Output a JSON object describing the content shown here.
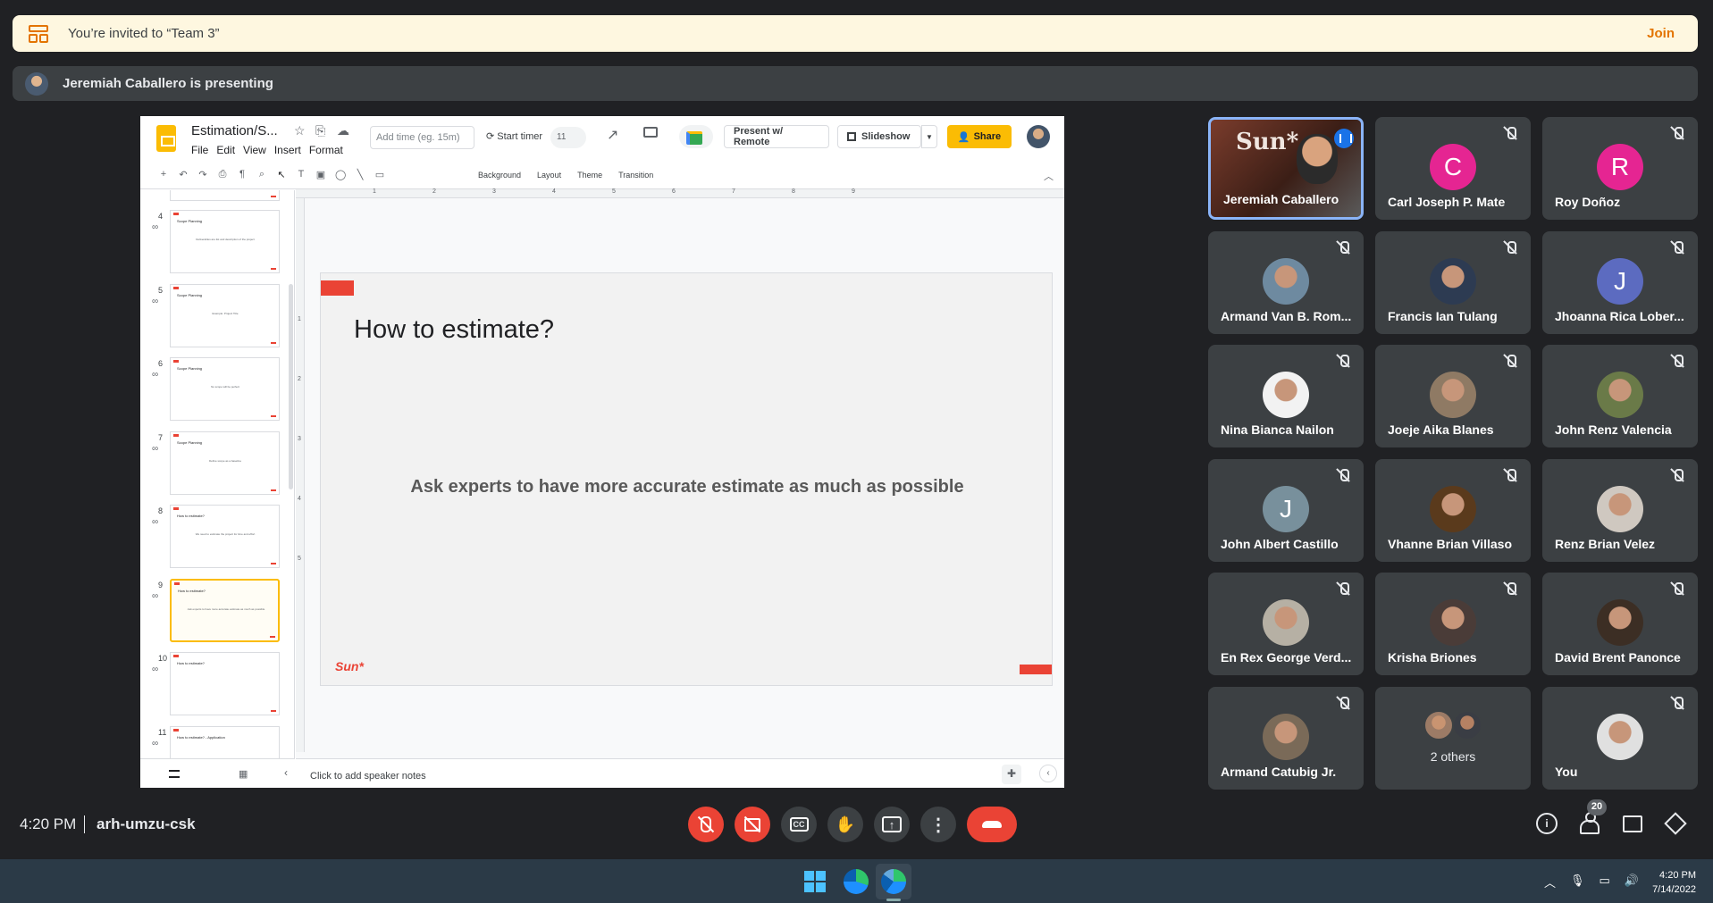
{
  "invite": {
    "text": "You’re invited to “Team 3”",
    "join_label": "Join"
  },
  "presenting": {
    "text": "Jeremiah Caballero is presenting"
  },
  "slides_app": {
    "doc_title": "Estimation/S...",
    "menu": [
      "File",
      "Edit",
      "View",
      "Insert",
      "Format"
    ],
    "time_placeholder": "Add time (eg. 15m)",
    "start_timer_label": "Start timer",
    "timer_badge": "11",
    "present_remote_label": "Present w/ Remote",
    "slideshow_label": "Slideshow",
    "share_label": "Share",
    "toolbar_labels": [
      "Background",
      "Layout",
      "Theme",
      "Transition"
    ],
    "speaker_notes_placeholder": "Click to add speaker notes",
    "filmstrip": [
      {
        "num": "4",
        "title": "Scope Planning",
        "body": "Deliverables are list and description of the project"
      },
      {
        "num": "5",
        "title": "Scope Planning",
        "body": "Example: Project Title"
      },
      {
        "num": "6",
        "title": "Scope Planning",
        "body": "No scope will be perfect"
      },
      {
        "num": "7",
        "title": "Scope Planning",
        "body": "Define scope as a baseline"
      },
      {
        "num": "8",
        "title": "How to estimate?",
        "body": "We need to estimate the project for time and effort"
      },
      {
        "num": "9",
        "title": "How to estimate?",
        "body": "Ask experts to have more accurate estimate as much as possible",
        "selected": true
      },
      {
        "num": "10",
        "title": "How to estimate?",
        "body": ""
      },
      {
        "num": "11",
        "title": "How to estimate? - Application",
        "body": ""
      }
    ],
    "ruler_h": [
      "1",
      "2",
      "3",
      "4",
      "5",
      "6",
      "7",
      "8",
      "9"
    ],
    "ruler_v": [
      "1",
      "2",
      "3",
      "4",
      "5"
    ],
    "slide": {
      "title": "How to estimate?",
      "body": "Ask experts to have more accurate estimate as much as possible",
      "logo": "Sun*",
      "accent_color": "#ea4335"
    }
  },
  "participants": [
    {
      "name": "Jeremiah Caballero",
      "type": "video",
      "speaking": true,
      "scene_text": "Sun*"
    },
    {
      "name": "Carl Joseph P. Mate",
      "type": "letter",
      "letter": "C",
      "color": "#e52592",
      "muted": true
    },
    {
      "name": "Roy Doñoz",
      "type": "letter",
      "letter": "R",
      "color": "#e52592",
      "muted": true
    },
    {
      "name": "Armand Van B. Rom...",
      "type": "photo",
      "tone": "#6e8aa0",
      "muted": true
    },
    {
      "name": "Francis Ian Tulang",
      "type": "photo",
      "tone": "#2d3b52",
      "muted": true
    },
    {
      "name": "Jhoanna Rica Lober...",
      "type": "letter",
      "letter": "J",
      "color": "#5c6bc0",
      "muted": true
    },
    {
      "name": "Nina Bianca Nailon",
      "type": "photo",
      "tone": "#f2f2f2",
      "muted": true
    },
    {
      "name": "Joeje Aika Blanes",
      "type": "photo",
      "tone": "#8f7a64",
      "muted": true
    },
    {
      "name": "John Renz Valencia",
      "type": "photo",
      "tone": "#6a7a48",
      "muted": true
    },
    {
      "name": "John Albert Castillo",
      "type": "letter",
      "letter": "J",
      "color": "#78909c",
      "muted": true
    },
    {
      "name": "Vhanne Brian Villaso",
      "type": "photo",
      "tone": "#5a3a1c",
      "muted": true
    },
    {
      "name": "Renz Brian Velez",
      "type": "photo",
      "tone": "#cfc8c0",
      "muted": true
    },
    {
      "name": "En Rex George Verd...",
      "type": "photo",
      "tone": "#b6b0a4",
      "muted": true
    },
    {
      "name": "Krisha Briones",
      "type": "photo",
      "tone": "#4a3c38",
      "muted": true
    },
    {
      "name": "David Brent Panonce",
      "type": "photo",
      "tone": "#3c2e24",
      "muted": true
    },
    {
      "name": "Armand Catubig Jr.",
      "type": "photo",
      "tone": "#7a6a58",
      "muted": true
    },
    {
      "name": "2 others",
      "type": "others",
      "muted": false
    },
    {
      "name": "You",
      "type": "photo",
      "tone": "#e0e0e0",
      "muted": true
    }
  ],
  "call": {
    "time": "4:20 PM",
    "meeting_code": "arh-umzu-csk",
    "people_count": "20"
  },
  "taskbar": {
    "time": "4:20 PM",
    "date": "7/14/2022"
  },
  "colors": {
    "end_call": "#ea4335",
    "speaking_border": "#8ab4f8",
    "invite_accent": "#e37400"
  }
}
